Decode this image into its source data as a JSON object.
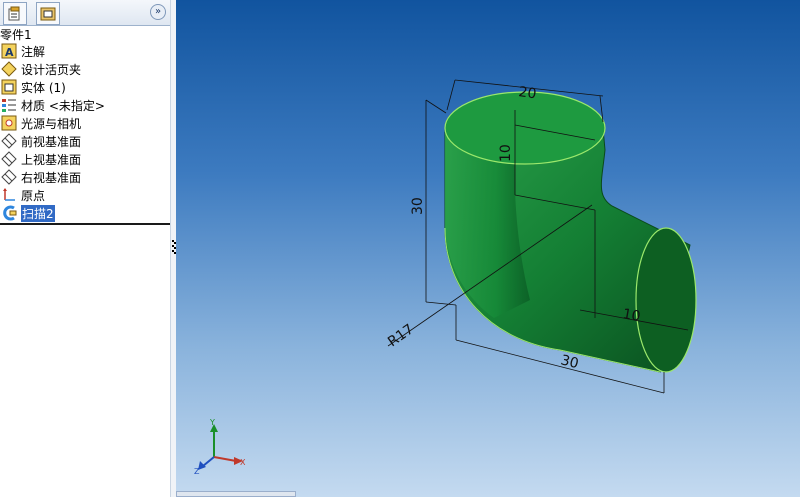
{
  "tree": {
    "root": "零件1",
    "items": [
      {
        "label": "注解",
        "icon": "annotation-icon"
      },
      {
        "label": "设计活页夹",
        "icon": "design-binder-icon"
      },
      {
        "label": "实体 (1)",
        "icon": "solid-bodies-icon"
      },
      {
        "label": "材质 <未指定>",
        "icon": "material-icon"
      },
      {
        "label": "光源与相机",
        "icon": "lights-cameras-icon"
      },
      {
        "label": "前视基准面",
        "icon": "plane-icon"
      },
      {
        "label": "上视基准面",
        "icon": "plane-icon"
      },
      {
        "label": "右视基准面",
        "icon": "plane-icon"
      },
      {
        "label": "原点",
        "icon": "origin-icon"
      },
      {
        "label": "扫描2",
        "icon": "sweep-feature-icon",
        "selected": true
      }
    ]
  },
  "toolbar": {
    "collapse": "»"
  },
  "model": {
    "color": "#1f8a3e",
    "dims": {
      "top_diameter": "20",
      "top_height": "10",
      "height": "30",
      "radius": "R17",
      "width": "30",
      "side_diameter": "10"
    }
  },
  "triad": {
    "x": "X",
    "y": "Y",
    "z": "Z"
  }
}
